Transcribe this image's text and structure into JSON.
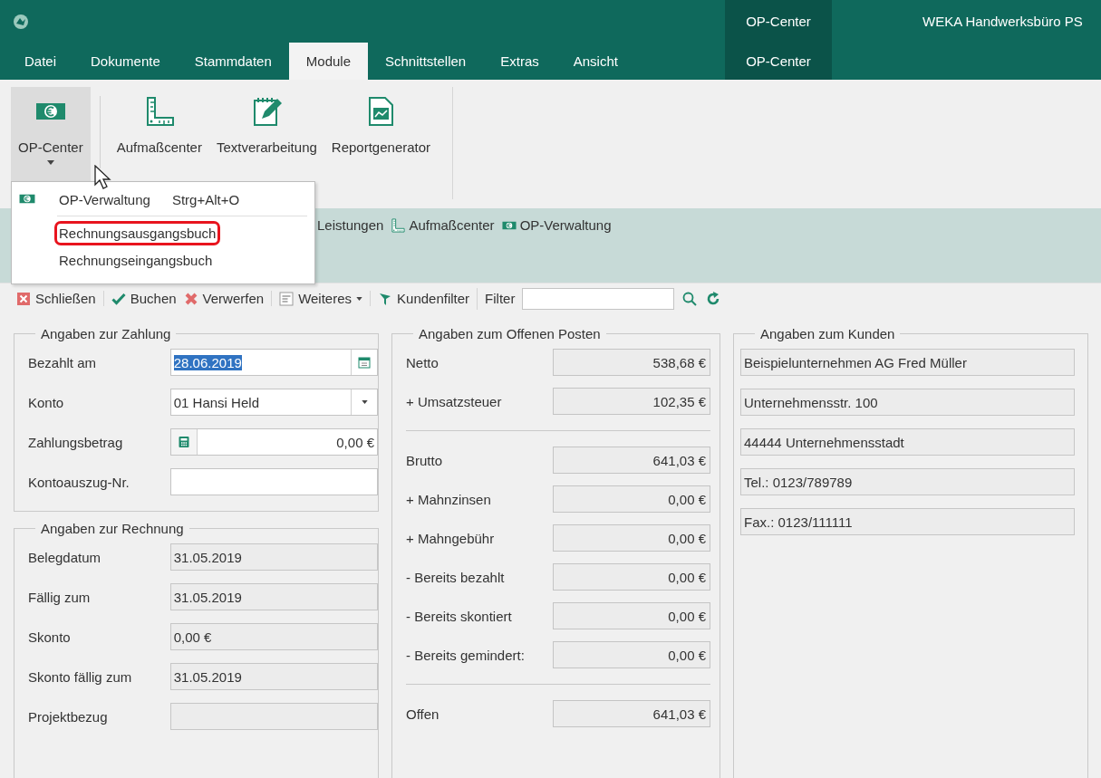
{
  "title_bar": {
    "context_group": "OP-Center",
    "app_title": "WEKA Handwerksbüro PS"
  },
  "menu_tabs": [
    {
      "label": "Datei",
      "selected": false,
      "context": false
    },
    {
      "label": "Dokumente",
      "selected": false,
      "context": false
    },
    {
      "label": "Stammdaten",
      "selected": false,
      "context": false
    },
    {
      "label": "Module",
      "selected": true,
      "context": false
    },
    {
      "label": "Schnittstellen",
      "selected": false,
      "context": false
    },
    {
      "label": "Extras",
      "selected": false,
      "context": false
    },
    {
      "label": "Ansicht",
      "selected": false,
      "context": false
    },
    {
      "label": "OP-Center",
      "selected": false,
      "context": true
    }
  ],
  "ribbon": {
    "buttons": [
      {
        "label": "OP-Center",
        "kind": "op-center",
        "pressed": true,
        "dropdown": true
      },
      {
        "label": "Aufmaßcenter",
        "kind": "measure",
        "pressed": false,
        "dropdown": false
      },
      {
        "label": "Textverarbeitung",
        "kind": "text",
        "pressed": false,
        "dropdown": false
      },
      {
        "label": "Reportgenerator",
        "kind": "report",
        "pressed": false,
        "dropdown": false
      }
    ]
  },
  "dropdown_menu": {
    "items": [
      {
        "label": "OP-Verwaltung",
        "shortcut": "Strg+Alt+O",
        "kind": "op-center",
        "highlighted": false,
        "separator_before": false
      },
      {
        "label": "Rechnungsausgangsbuch",
        "kind": "plain",
        "highlighted": true,
        "separator_before": true
      },
      {
        "label": "Rechnungseingangsbuch",
        "kind": "plain",
        "highlighted": false,
        "separator_before": false
      }
    ]
  },
  "quick_links": [
    {
      "label": "Leistungen",
      "kind": "plain"
    },
    {
      "label": "Aufmaßcenter",
      "kind": "measure"
    },
    {
      "label": "OP-Verwaltung",
      "kind": "op-center"
    }
  ],
  "toolbar": {
    "groups": [
      [
        {
          "kind": "close",
          "label": "Schließen"
        }
      ],
      [
        {
          "kind": "book",
          "label": "Buchen"
        },
        {
          "kind": "discard",
          "label": "Verwerfen"
        }
      ],
      [
        {
          "kind": "more",
          "label": "Weiteres"
        }
      ],
      [
        {
          "kind": "customer-filter",
          "label": "Kundenfilter"
        }
      ],
      [
        {
          "kind": "label",
          "label": "Filter"
        },
        {
          "kind": "field"
        },
        {
          "kind": "search"
        },
        {
          "kind": "refresh"
        }
      ]
    ]
  },
  "payment": {
    "title": "Angaben zur Zahlung",
    "rows": [
      {
        "label": "Bezahlt am",
        "kind": "date",
        "value": "28.06.2019",
        "value_selected": true
      },
      {
        "label": "Konto",
        "kind": "select",
        "value": "01 Hansi Held"
      },
      {
        "label": "Zahlungsbetrag",
        "kind": "calc",
        "value": "0,00 €"
      },
      {
        "label": "Kontoauszug-Nr.",
        "kind": "text"
      }
    ]
  },
  "invoice": {
    "title": "Angaben zur Rechnung",
    "rows": [
      {
        "label": "Belegdatum",
        "kind": "readonly",
        "value": "31.05.2019"
      },
      {
        "label": "Fällig zum",
        "kind": "readonly",
        "value": "31.05.2019"
      },
      {
        "label": "Skonto",
        "kind": "readonly",
        "value": "0,00 €"
      },
      {
        "label": "Skonto fällig zum",
        "kind": "readonly",
        "value": "31.05.2019"
      },
      {
        "label": "Projektbezug",
        "kind": "readonly"
      }
    ]
  },
  "open_item": {
    "title": "Angaben zum Offenen Posten",
    "sections": [
      [
        {
          "label": "Netto",
          "value": "538,68 €"
        },
        {
          "label": "+ Umsatzsteuer",
          "value": "102,35 €"
        }
      ],
      [
        {
          "label": "Brutto",
          "value": "641,03 €"
        },
        {
          "label": "+ Mahnzinsen",
          "value": "0,00 €"
        },
        {
          "label": "+ Mahngebühr",
          "value": "0,00 €"
        },
        {
          "label": "- Bereits bezahlt",
          "value": "0,00 €"
        },
        {
          "label": "- Bereits skontiert",
          "value": "0,00 €"
        },
        {
          "label": "- Bereits gemindert:",
          "value": "0,00 €"
        }
      ],
      [
        {
          "label": "Offen",
          "value": "641,03 €"
        }
      ]
    ]
  },
  "customer": {
    "title": "Angaben zum Kunden",
    "lines": [
      "Beispielunternehmen AG Fred Müller",
      "Unternehmensstr. 100",
      "44444 Unternehmensstadt",
      "Tel.: 0123/789789",
      "Fax.: 0123/111111"
    ]
  }
}
